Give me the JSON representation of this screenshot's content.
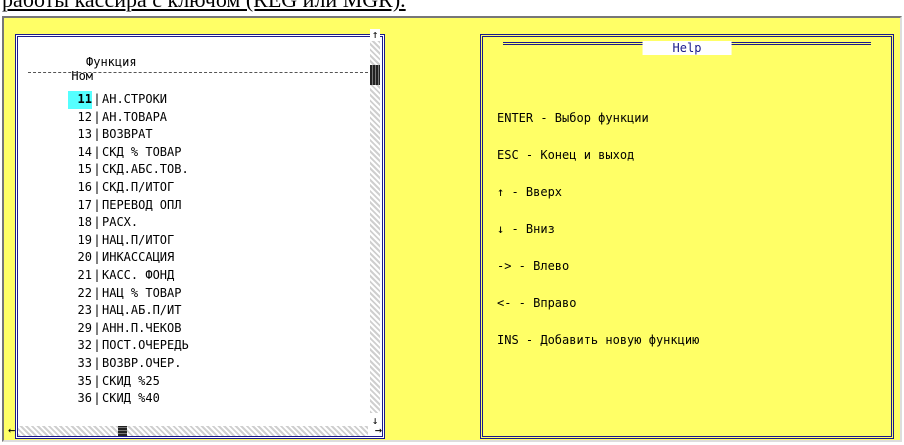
{
  "caption": "работы кассира с ключом (REG или MGR).",
  "left_panel": {
    "col_num": "Ном",
    "col_func": "Функция",
    "selected_index": 0,
    "rows": [
      {
        "num": "11",
        "name": "АН.СТРОКИ"
      },
      {
        "num": "12",
        "name": "АН.ТОВАРА"
      },
      {
        "num": "13",
        "name": "ВОЗВРАТ"
      },
      {
        "num": "14",
        "name": "СКД % ТОВАР"
      },
      {
        "num": "15",
        "name": "СКД.АБС.ТОВ."
      },
      {
        "num": "16",
        "name": "СКД.П/ИТОГ"
      },
      {
        "num": "17",
        "name": "ПЕРЕВОД ОПЛ"
      },
      {
        "num": "18",
        "name": "РАСХ."
      },
      {
        "num": "19",
        "name": "НАЦ.П/ИТОГ"
      },
      {
        "num": "20",
        "name": "ИНКАССАЦИЯ"
      },
      {
        "num": "21",
        "name": "КАСС. ФОНД"
      },
      {
        "num": "22",
        "name": "НАЦ % ТОВАР"
      },
      {
        "num": "23",
        "name": "НАЦ.АБ.П/ИТ"
      },
      {
        "num": "29",
        "name": "АНН.П.ЧЕКОВ"
      },
      {
        "num": "32",
        "name": "ПОСТ.ОЧЕРЕДЬ"
      },
      {
        "num": "33",
        "name": "ВОЗВР.ОЧЕР."
      },
      {
        "num": "35",
        "name": "СКИД %25"
      },
      {
        "num": "36",
        "name": "СКИД %40"
      }
    ],
    "scroll_up": "↑",
    "scroll_down": "↓",
    "scroll_left": "←",
    "scroll_right": "→"
  },
  "help_panel": {
    "title": "Help",
    "items": [
      "ENTER - Выбор функции",
      "ESC - Конец и выход",
      "↑ - Вверх",
      "↓ - Вниз",
      "-> - Влево",
      "<- - Вправо",
      "INS - Добавить новую функцию"
    ]
  },
  "colors": {
    "background": "#ffff66",
    "frame": "#1a1a8c",
    "selection": "#55ffff"
  }
}
